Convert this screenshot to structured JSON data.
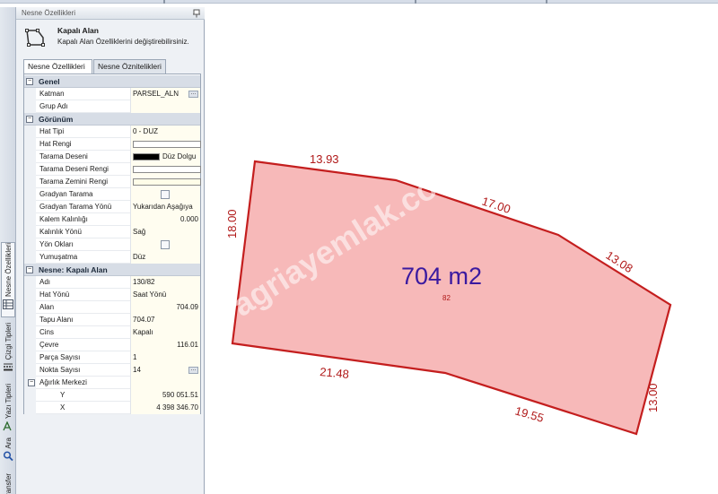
{
  "panel": {
    "title": "Nesne Özellikleri",
    "pin_icon": "pin-icon"
  },
  "header": {
    "icon": "polygon-object-icon",
    "title": "Kapalı Alan",
    "subtitle": "Kapalı Alan Özelliklerini değiştirebilirsiniz."
  },
  "tabs": [
    {
      "label": "Nesne Özellikleri",
      "active": true
    },
    {
      "label": "Nesne Öznitelikleri",
      "active": false
    }
  ],
  "vertical_tabs": [
    {
      "label": "Nesne Özellikleri",
      "icon": "properties-grid-icon",
      "active": true
    },
    {
      "label": "Çizgi Tipleri",
      "icon": "line-types-icon",
      "active": false
    },
    {
      "label": "Yazı Tipleri",
      "icon": "font-icon",
      "active": false
    },
    {
      "label": "Ara",
      "icon": "search-icon",
      "active": false
    },
    {
      "label": "ransfer",
      "icon": "transfer-icon",
      "active": false
    }
  ],
  "grid": {
    "categories": {
      "genel": "Genel",
      "gorunum": "Görünüm",
      "nesne": "Nesne: Kapalı Alan"
    },
    "genel": [
      {
        "name": "Katman",
        "value": "PARSEL_ALN"
      },
      {
        "name": "Grup Adı",
        "value": ""
      }
    ],
    "gorunum": [
      {
        "name": "Hat Tipi",
        "value": "0 - DUZ"
      },
      {
        "name": "Hat Rengi",
        "value": ""
      },
      {
        "name": "Tarama Deseni",
        "value": "Düz Dolgu"
      },
      {
        "name": "Tarama Deseni Rengi",
        "value": ""
      },
      {
        "name": "Tarama Zemini Rengi",
        "value": ""
      },
      {
        "name": "Gradyan Tarama",
        "value": ""
      },
      {
        "name": "Gradyan Tarama Yönü",
        "value": "Yukarıdan Aşağıya"
      },
      {
        "name": "Kalem Kalınlığı",
        "value": "0.000"
      },
      {
        "name": "Kalınlık Yönü",
        "value": "Sağ"
      },
      {
        "name": "Yön Okları",
        "value": ""
      },
      {
        "name": "Yumuşatma",
        "value": "Düz"
      }
    ],
    "nesne": [
      {
        "name": "Adı",
        "value": "130/82"
      },
      {
        "name": "Hat Yönü",
        "value": "Saat Yönü"
      },
      {
        "name": "Alan",
        "value": "704.09"
      },
      {
        "name": "Tapu Alanı",
        "value": "704.07"
      },
      {
        "name": "Cins",
        "value": "Kapalı"
      },
      {
        "name": "Çevre",
        "value": "116.01"
      },
      {
        "name": "Parça Sayısı",
        "value": "1"
      },
      {
        "name": "Nokta Sayısı",
        "value": "14"
      },
      {
        "name": "Ağırlık Merkezi",
        "value": ""
      },
      {
        "name": "Y",
        "value": "590 051.51"
      },
      {
        "name": "X",
        "value": "4 398 346.70"
      }
    ]
  },
  "drawing": {
    "area_label": "704 m2",
    "parcel_number": "82",
    "watermark": "agriayemlak.com",
    "fill_color": "#f7b9b9",
    "stroke_color": "#c41e1e",
    "edge_lengths": [
      "13.93",
      "17.00",
      "13.08",
      "13.00",
      "19.55",
      "21.48",
      "18.00"
    ]
  }
}
